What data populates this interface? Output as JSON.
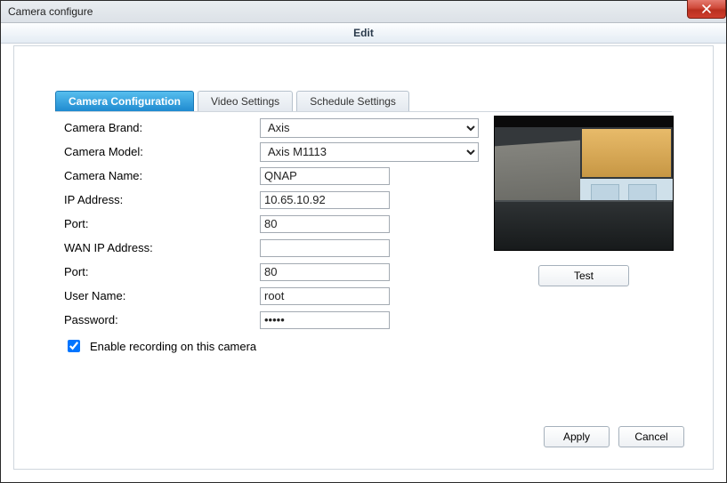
{
  "window": {
    "title": "Camera configure",
    "sub_title": "Edit"
  },
  "tabs": {
    "camera_configuration": "Camera Configuration",
    "video_settings": "Video Settings",
    "schedule_settings": "Schedule Settings"
  },
  "labels": {
    "camera_brand": "Camera Brand:",
    "camera_model": "Camera Model:",
    "camera_name": "Camera Name:",
    "ip_address": "IP Address:",
    "port": "Port:",
    "wan_ip_address": "WAN IP Address:",
    "port2": "Port:",
    "user_name": "User Name:",
    "password": "Password:",
    "enable_recording": "Enable recording on this camera"
  },
  "values": {
    "camera_brand": "Axis",
    "camera_model": "Axis M1113",
    "camera_name": "QNAP",
    "ip_address": "10.65.10.92",
    "port": "80",
    "wan_ip_address": "",
    "port2": "80",
    "user_name": "root",
    "password": "•••••",
    "enable_recording": true
  },
  "buttons": {
    "test": "Test",
    "apply": "Apply",
    "cancel": "Cancel"
  }
}
